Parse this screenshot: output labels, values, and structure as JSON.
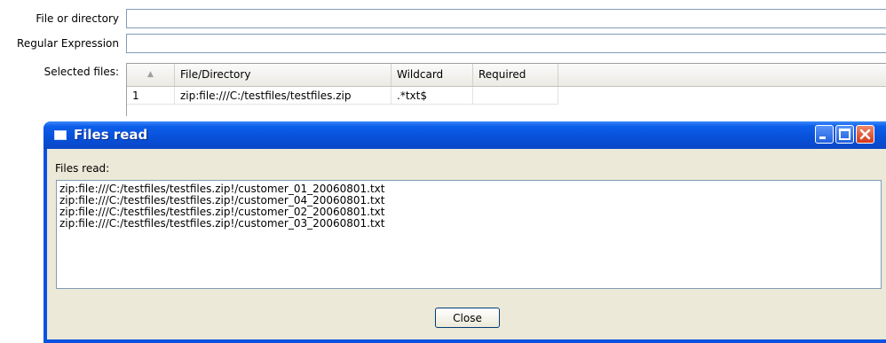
{
  "form": {
    "file_label": "File or directory",
    "file_value": "",
    "regex_label": "Regular Expression",
    "regex_value": "",
    "selected_label": "Selected files:"
  },
  "table": {
    "columns": [
      "File/Directory",
      "Wildcard",
      "Required"
    ],
    "sort_indicator": "▲",
    "rows": [
      {
        "num": "1",
        "file": "zip:file:///C:/testfiles/testfiles.zip",
        "wildcard": ".*txt$",
        "required": ""
      }
    ]
  },
  "dialog": {
    "title": "Files read",
    "label": "Files read:",
    "lines": [
      "zip:file:///C:/testfiles/testfiles.zip!/customer_01_20060801.txt",
      "zip:file:///C:/testfiles/testfiles.zip!/customer_04_20060801.txt",
      "zip:file:///C:/testfiles/testfiles.zip!/customer_02_20060801.txt",
      "zip:file:///C:/testfiles/testfiles.zip!/customer_03_20060801.txt"
    ],
    "close_label": "Close",
    "icons": [
      "window-icon",
      "minimize-icon",
      "maximize-icon",
      "close-icon"
    ]
  },
  "colors": {
    "titlebar": "#0a52e0",
    "dialog_bg": "#ece9d8",
    "close_btn": "#d2381a"
  }
}
